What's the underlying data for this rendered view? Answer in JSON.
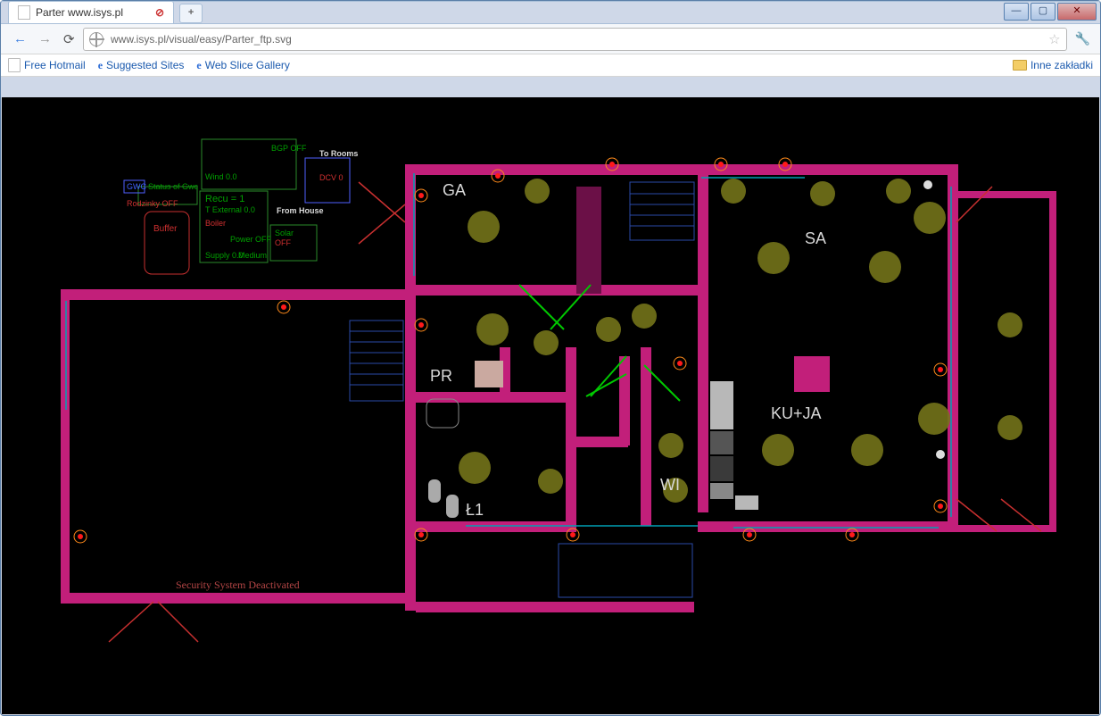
{
  "browser": {
    "tab_title": "Parter www.isys.pl",
    "url": "www.isys.pl/visual/easy/Parter_ftp.svg"
  },
  "bookmarks": [
    {
      "label": "Free Hotmail",
      "icon": "page"
    },
    {
      "label": "Suggested Sites",
      "icon": "ie"
    },
    {
      "label": "Web Slice Gallery",
      "icon": "ie"
    }
  ],
  "bookmarks_overflow": "Inne zakładki",
  "floorplan": {
    "rooms": {
      "ga": "GA",
      "sa": "SA",
      "pr": "PR",
      "l1": "Ł1",
      "wi": "WI",
      "ku_ja": "KU+JA"
    },
    "status": {
      "security": "Security System Deactivated"
    },
    "hvac_panel": {
      "gwc": "GWC",
      "status_of_gwc": "Status of Gwc",
      "rodzinky_off": "Rodzinky OFF",
      "recu": "Recu = 1",
      "t_external": "T External 0.0",
      "wind": "Wind 0.0",
      "boiler": "Boiler",
      "supply": "Supply 0.0",
      "buffer": "Buffer",
      "power_off": "Power OFF",
      "medium": "Medium",
      "solar": "Solar",
      "solar_off": "OFF",
      "bgp_off": "BGP OFF",
      "to_rooms": "To Rooms",
      "from_house": "From House",
      "dcv": "DCV 0"
    }
  }
}
